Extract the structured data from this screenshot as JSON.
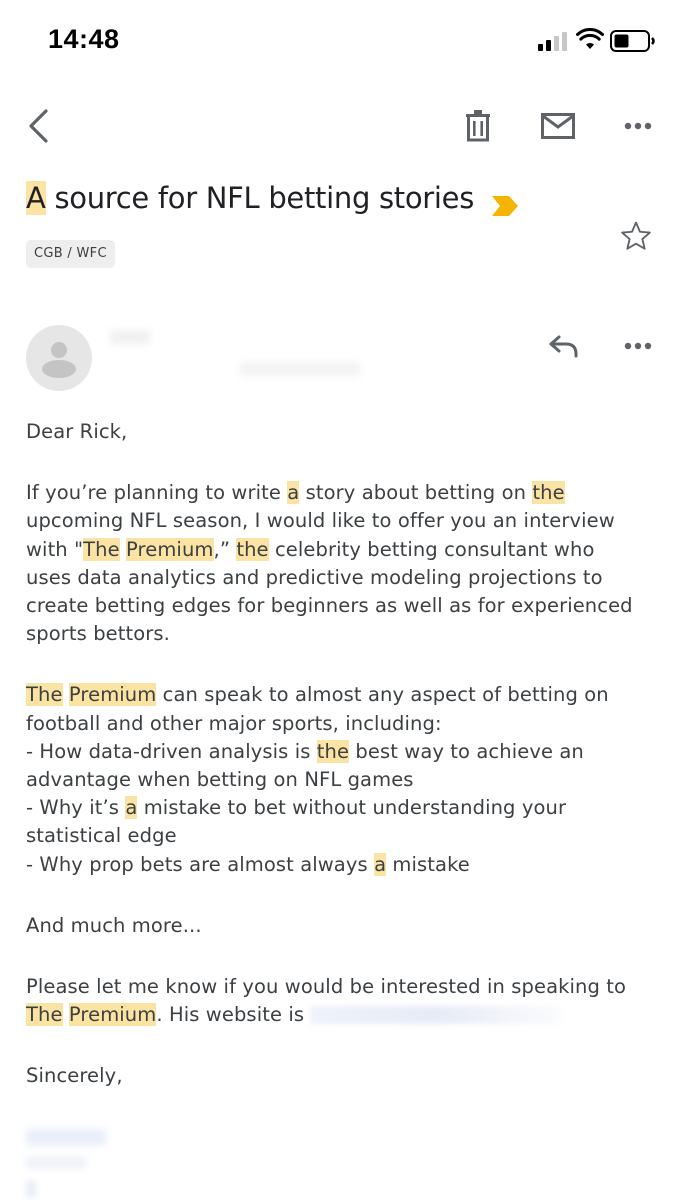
{
  "status_bar": {
    "time": "14:48"
  },
  "toolbar": {
    "back_icon": "chevron-left-icon",
    "delete_icon": "trash-icon",
    "mail_icon": "mail-icon",
    "more_icon": "more-horizontal-icon"
  },
  "subject": {
    "first_word": "A",
    "rest": " source for NFL betting stories",
    "label_chip": "CGB / WFC"
  },
  "sender": {
    "reply_icon": "reply-icon",
    "more_icon": "more-horizontal-icon"
  },
  "message": {
    "greeting": "Dear Rick,",
    "para1": {
      "l1a": "If you’re planning to write ",
      "l1b": "a",
      "l1c": " story about betting on ",
      "l1d": "the",
      "l2": "upcoming NFL season, I would like to offer you an interview",
      "l3a": "with \"",
      "l3b": "The",
      "l3c": " ",
      "l3d": "Premium",
      "l3e": ",” ",
      "l3f": "the",
      "l3g": " celebrity betting consultant who",
      "l4": "uses data analytics and predictive modeling projections to",
      "l5": "create betting edges for beginners as well as for experienced",
      "l6": "sports bettors."
    },
    "para2": {
      "l1a": "The",
      "l1b": " ",
      "l1c": "Premium",
      "l1d": " can speak to almost any aspect of betting on",
      "l2": "football and other major sports, including:",
      "l3a": "- How data-driven analysis is ",
      "l3b": "the",
      "l3c": " best way to achieve an",
      "l4": "advantage when betting on NFL games",
      "l5a": "- Why it’s ",
      "l5b": "a",
      "l5c": " mistake to bet without understanding your",
      "l6": "statistical edge",
      "l7a": "- Why prop bets are almost always ",
      "l7b": "a",
      "l7c": " mistake"
    },
    "para3": "And much more...",
    "para4": {
      "l1": "Please let me know if you would be interested in speaking to",
      "l2a": "The",
      "l2b": " ",
      "l2c": "Premium",
      "l2d": ". His website is "
    },
    "closing": "Sincerely,"
  },
  "colors": {
    "highlight": "#fbe3a3",
    "label_marker": "#f4b400",
    "icon_gray": "#5f6368"
  }
}
